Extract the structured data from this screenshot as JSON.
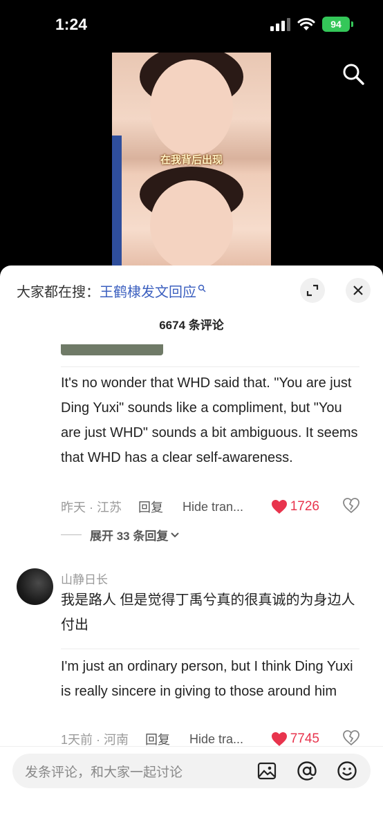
{
  "status_bar": {
    "time": "1:24",
    "battery": "94"
  },
  "video": {
    "caption": "在我背后出现"
  },
  "sheet": {
    "hot_search_prefix": "大家都在搜：",
    "hot_search_term": "王鹤棣发文回应",
    "comment_count": "6674 条评论"
  },
  "comments": [
    {
      "text": "It's no wonder that WHD said that. \"You are just Ding Yuxi\" sounds like a compliment, but \"You are just WHD\" sounds a bit ambiguous. It seems that WHD has a clear self-awareness.",
      "time_location": "昨天 · 江苏",
      "reply_label": "回复",
      "translate_label": "Hide tran...",
      "likes": "1726",
      "expand_replies": "展开 33 条回复"
    },
    {
      "username": "山静日长",
      "original_text": "我是路人 但是觉得丁禹兮真的很真诚的为身边人付出",
      "translated_text": "I'm just an ordinary person, but I think Ding Yuxi is really sincere in giving to those around him",
      "time_location": "1天前 · 河南",
      "reply_label": "回复",
      "translate_label": "Hide tra...",
      "likes": "7745"
    }
  ],
  "input_bar": {
    "placeholder": "发条评论，和大家一起讨论"
  },
  "colors": {
    "accent_link": "#3b5fbf",
    "like_red": "#e8344d",
    "battery_green": "#34c759"
  },
  "icons": [
    "search-icon",
    "expand-icon",
    "close-icon",
    "heart-icon",
    "broken-heart-icon",
    "chevron-down-icon",
    "image-icon",
    "at-icon",
    "emoji-icon"
  ]
}
